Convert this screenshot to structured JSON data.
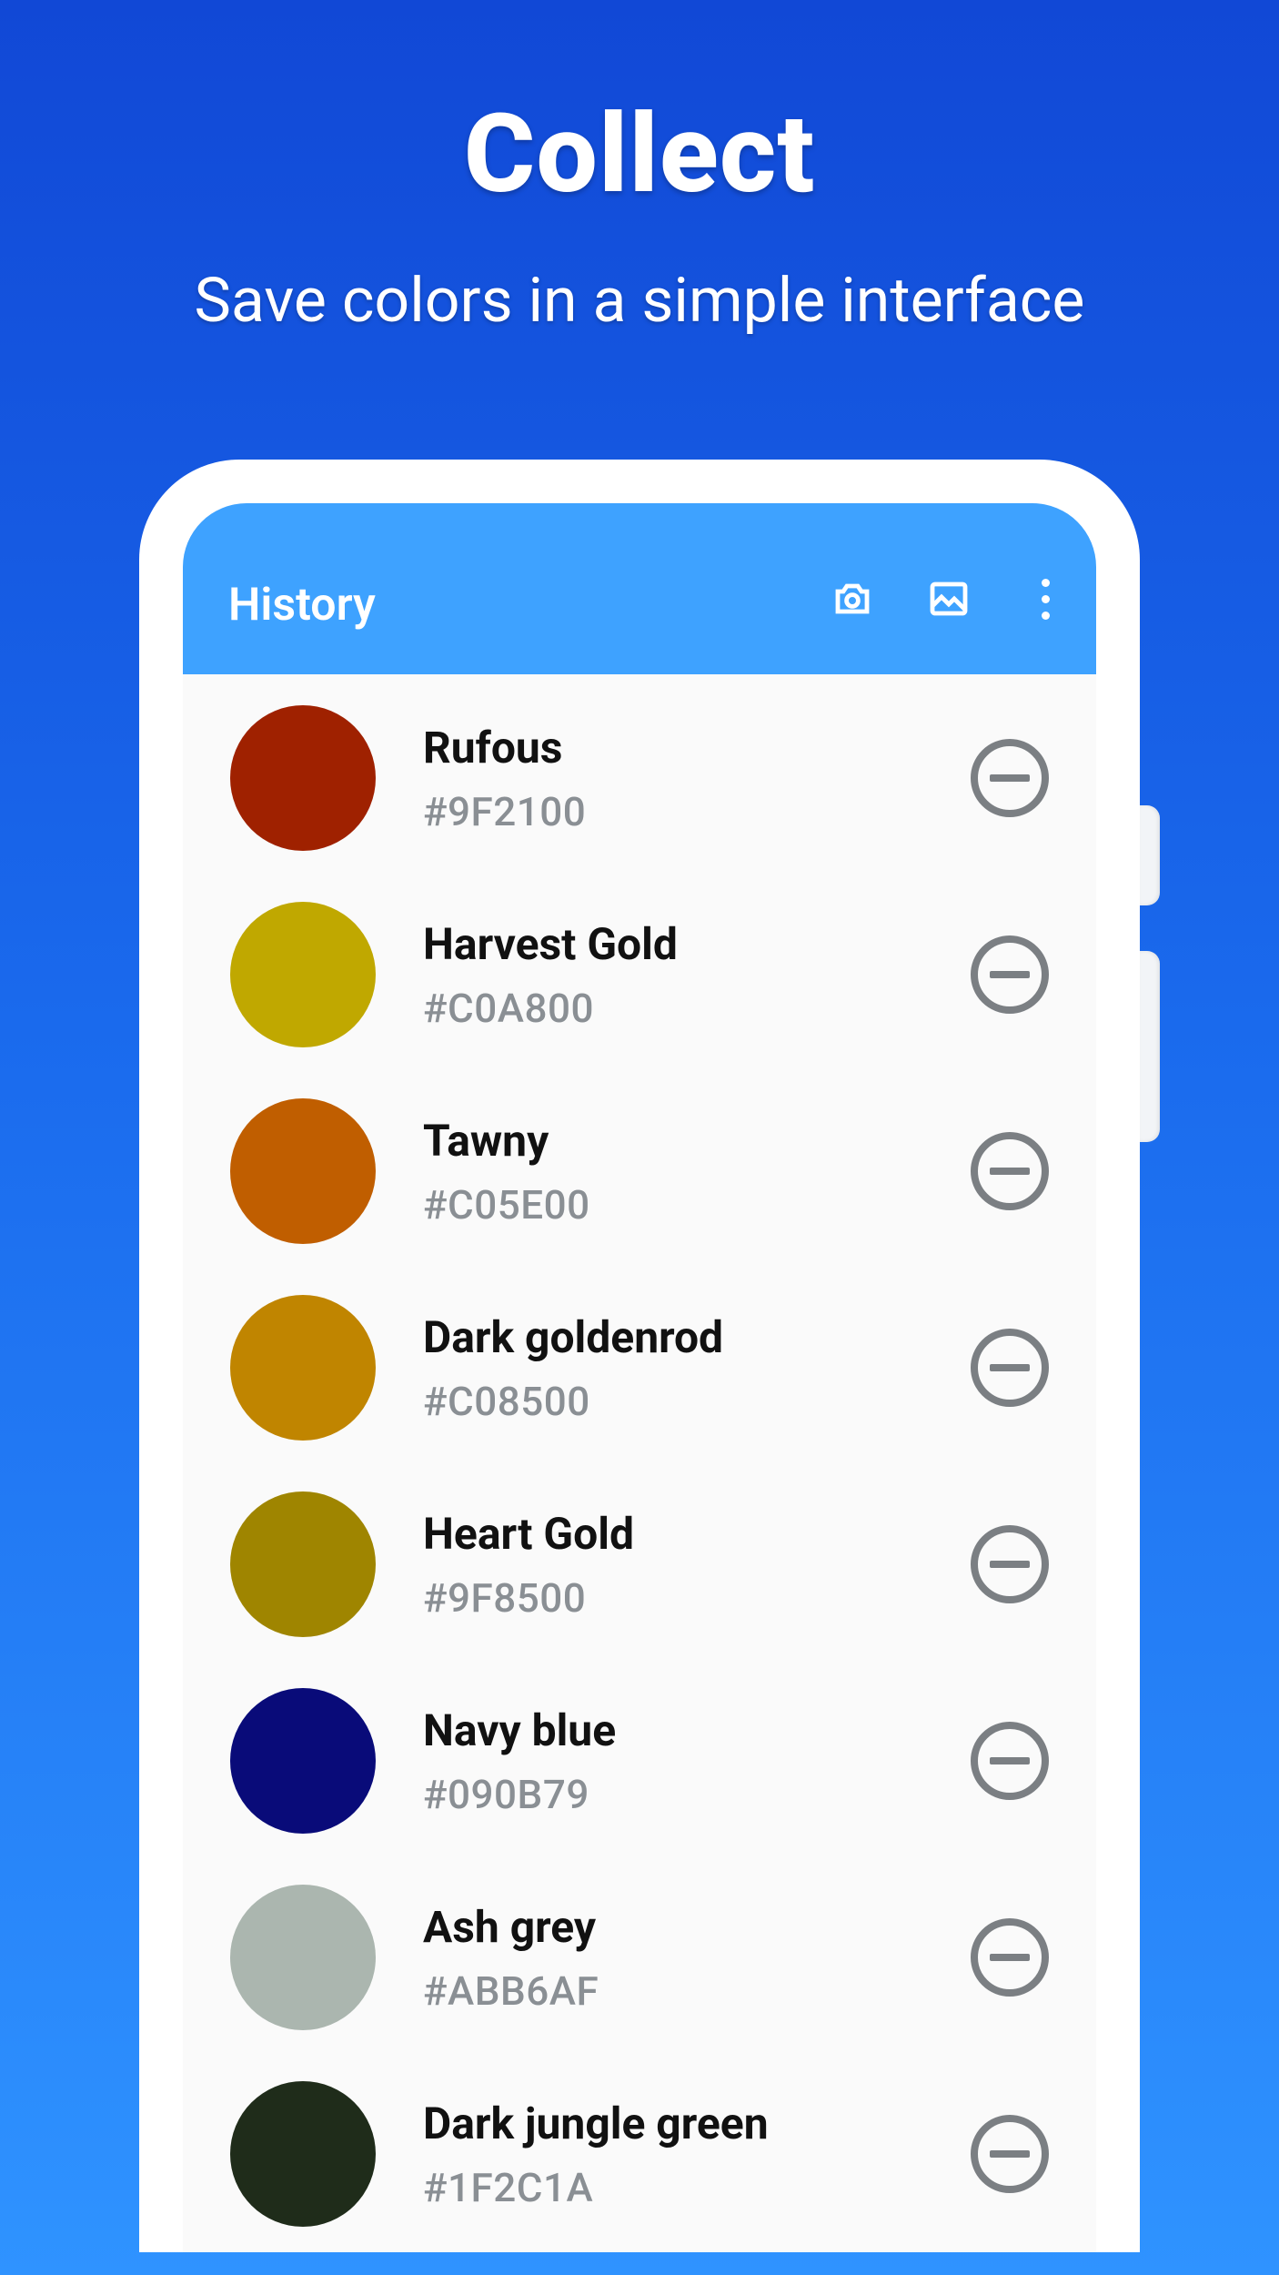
{
  "hero": {
    "title": "Collect",
    "subtitle": "Save colors in a simple interface"
  },
  "appbar": {
    "title": "History",
    "icons": {
      "camera": "camera-icon",
      "image": "image-icon",
      "more": "more-icon"
    }
  },
  "colors": [
    {
      "name": "Rufous",
      "hex": "#9F2100",
      "swatch": "#9F2100"
    },
    {
      "name": "Harvest Gold",
      "hex": "#C0A800",
      "swatch": "#C0A800"
    },
    {
      "name": "Tawny",
      "hex": "#C05E00",
      "swatch": "#C05E00"
    },
    {
      "name": "Dark goldenrod",
      "hex": "#C08500",
      "swatch": "#C08500"
    },
    {
      "name": "Heart Gold",
      "hex": "#9F8500",
      "swatch": "#9F8500"
    },
    {
      "name": "Navy blue",
      "hex": "#090B79",
      "swatch": "#090B79"
    },
    {
      "name": "Ash grey",
      "hex": "#ABB6AF",
      "swatch": "#ABB6AF"
    },
    {
      "name": "Dark jungle green",
      "hex": "#1F2C1A",
      "swatch": "#1F2C1A"
    }
  ]
}
